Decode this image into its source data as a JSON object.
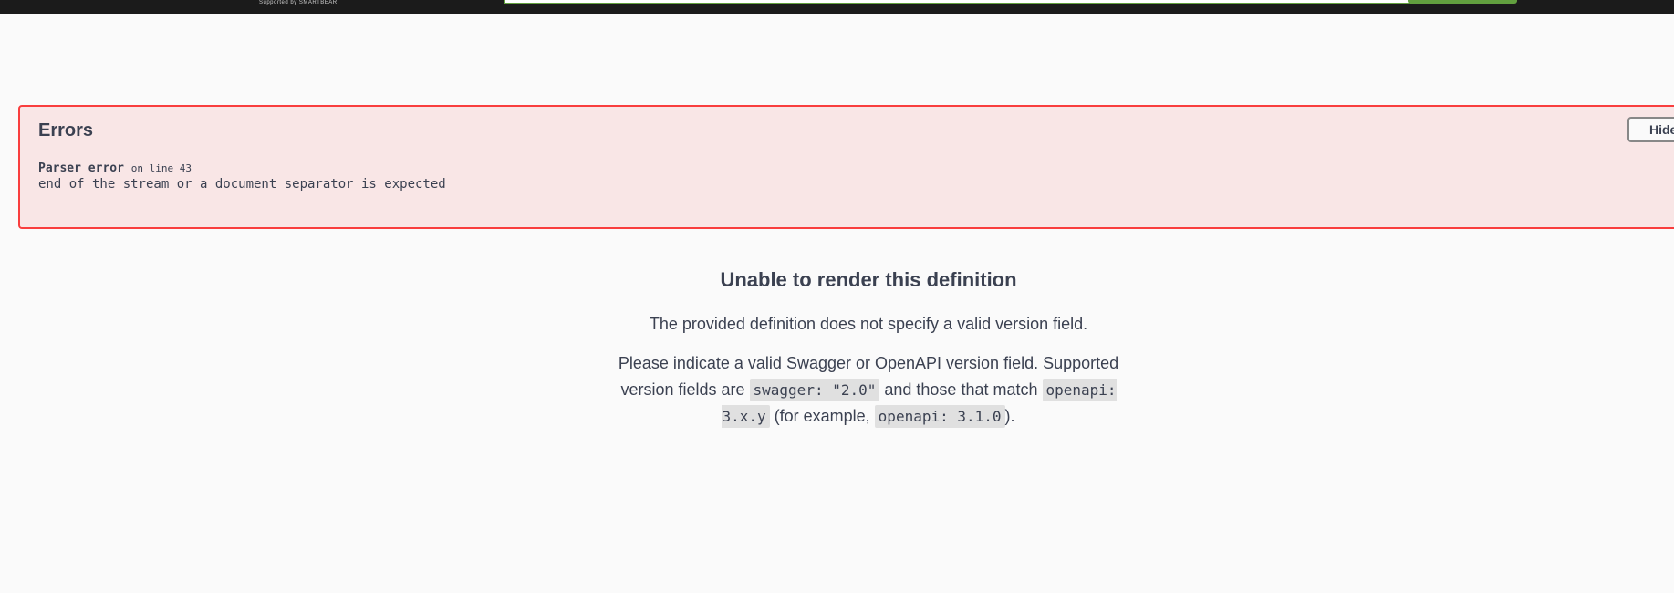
{
  "topbar": {
    "brand_text": "Supported by SMARTBEAR"
  },
  "errors": {
    "title": "Errors",
    "hide_label": "Hide",
    "items": [
      {
        "type": "Parser error",
        "location": "on line 43",
        "message": "end of the stream or a document separator is expected"
      }
    ]
  },
  "fallback": {
    "title": "Unable to render this definition",
    "p1": "The provided definition does not specify a valid version field.",
    "p2_part1": "Please indicate a valid Swagger or OpenAPI version field. Supported version fields are ",
    "p2_code1": "swagger: \"2.0\"",
    "p2_part2": " and those that match ",
    "p2_code2": "openapi: 3.x.y",
    "p2_part3": " (for example, ",
    "p2_code3": "openapi: 3.1.0",
    "p2_part4": ")."
  },
  "colors": {
    "error_border": "#f93e3e",
    "accent_green": "#62a03f",
    "topbar_bg": "#1b1b1b",
    "text": "#3b4151"
  }
}
